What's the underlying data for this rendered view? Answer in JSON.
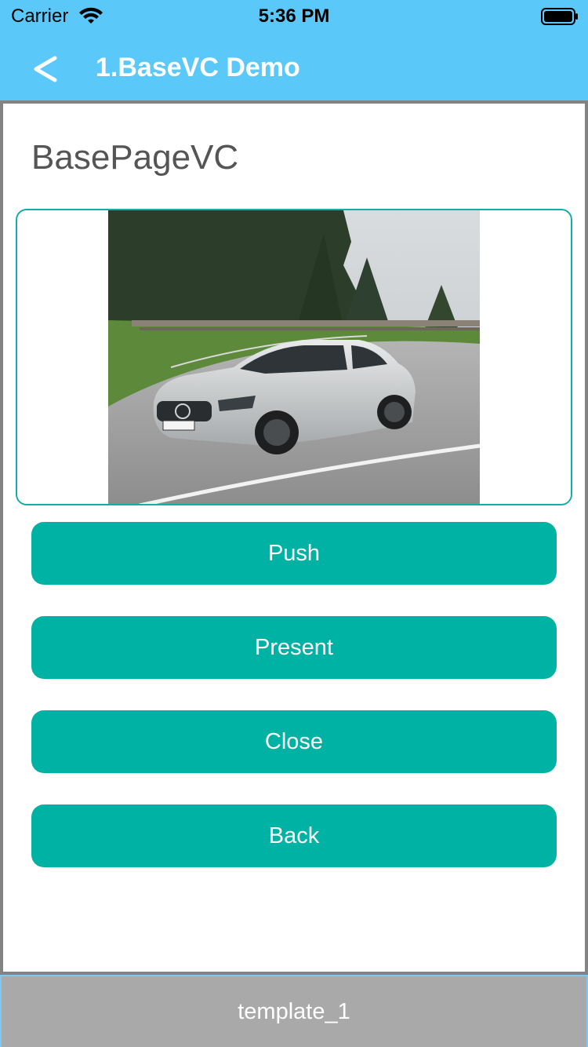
{
  "status_bar": {
    "carrier": "Carrier",
    "time": "5:36 PM",
    "wifi_icon": "wifi-icon",
    "battery_icon": "battery-icon"
  },
  "navbar": {
    "back_icon": "chevron-left-icon",
    "title": "1.BaseVC Demo",
    "background": "#5bc8fa"
  },
  "page": {
    "title": "BasePageVC",
    "image": "car-photo"
  },
  "buttons": [
    {
      "label": "Push"
    },
    {
      "label": "Present"
    },
    {
      "label": "Close"
    },
    {
      "label": "Back"
    }
  ],
  "tabbar": {
    "label": "template_1"
  },
  "colors": {
    "accent": "#00b2a4",
    "frame": "#18ada4",
    "tabbar": "#a9a9a9"
  }
}
